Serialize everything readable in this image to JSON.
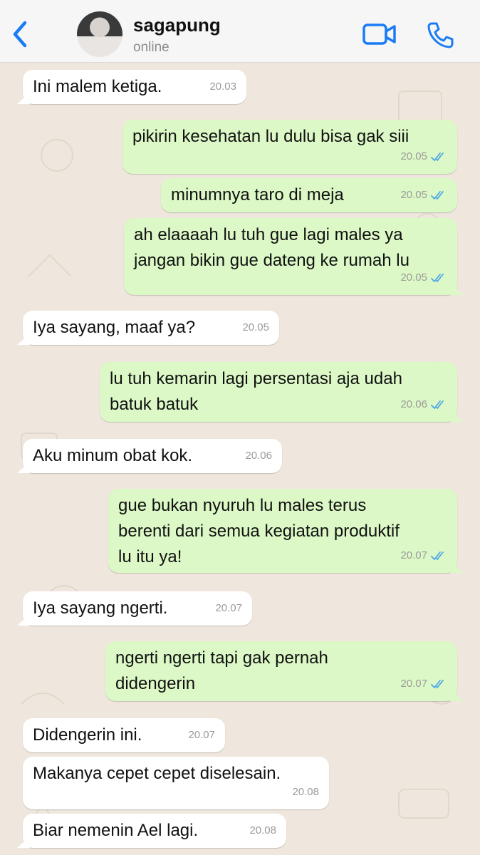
{
  "header": {
    "contact_name": "sagapung",
    "status": "online",
    "icons": {
      "back": "chevron-left-icon",
      "video": "video-camera-icon",
      "call": "phone-icon"
    },
    "accent": "#1a7cf5"
  },
  "messages": [
    {
      "dir": "in",
      "text": "Ini malem ketiga.",
      "time": "20.03"
    },
    {
      "dir": "out",
      "text": "pikirin kesehatan lu dulu bisa gak siii",
      "time": "20.05",
      "read": true
    },
    {
      "dir": "out",
      "text": "minumnya taro di meja",
      "time": "20.05",
      "read": true
    },
    {
      "dir": "out",
      "text": "ah elaaaah lu tuh gue lagi males ya\njangan bikin gue dateng ke rumah lu",
      "time": "20.05",
      "read": true
    },
    {
      "dir": "in",
      "text": "Iya sayang, maaf ya?",
      "time": "20.05"
    },
    {
      "dir": "out",
      "text": "lu tuh kemarin lagi persentasi aja udah\nbatuk batuk",
      "time": "20.06",
      "read": true
    },
    {
      "dir": "in",
      "text": "Aku minum obat kok.",
      "time": "20.06"
    },
    {
      "dir": "out",
      "text": "gue bukan nyuruh lu males terus\nberenti dari semua kegiatan produktif\nlu itu ya!",
      "time": "20.07",
      "read": true
    },
    {
      "dir": "in",
      "text": "Iya sayang ngerti.",
      "time": "20.07"
    },
    {
      "dir": "out",
      "text": "ngerti ngerti tapi gak pernah\ndidengerin",
      "time": "20.07",
      "read": true
    },
    {
      "dir": "in",
      "text": "Didengerin ini.",
      "time": "20.07"
    },
    {
      "dir": "in",
      "text": "Makanya cepet cepet diselesain.",
      "time": "20.08"
    },
    {
      "dir": "in",
      "text": "Biar nemenin Ael lagi.",
      "time": "20.08"
    }
  ],
  "colors": {
    "incoming": "#ffffff",
    "outgoing": "#dcf8c6",
    "read_tick": "#4fa7e8",
    "background": "#efe7dd"
  }
}
